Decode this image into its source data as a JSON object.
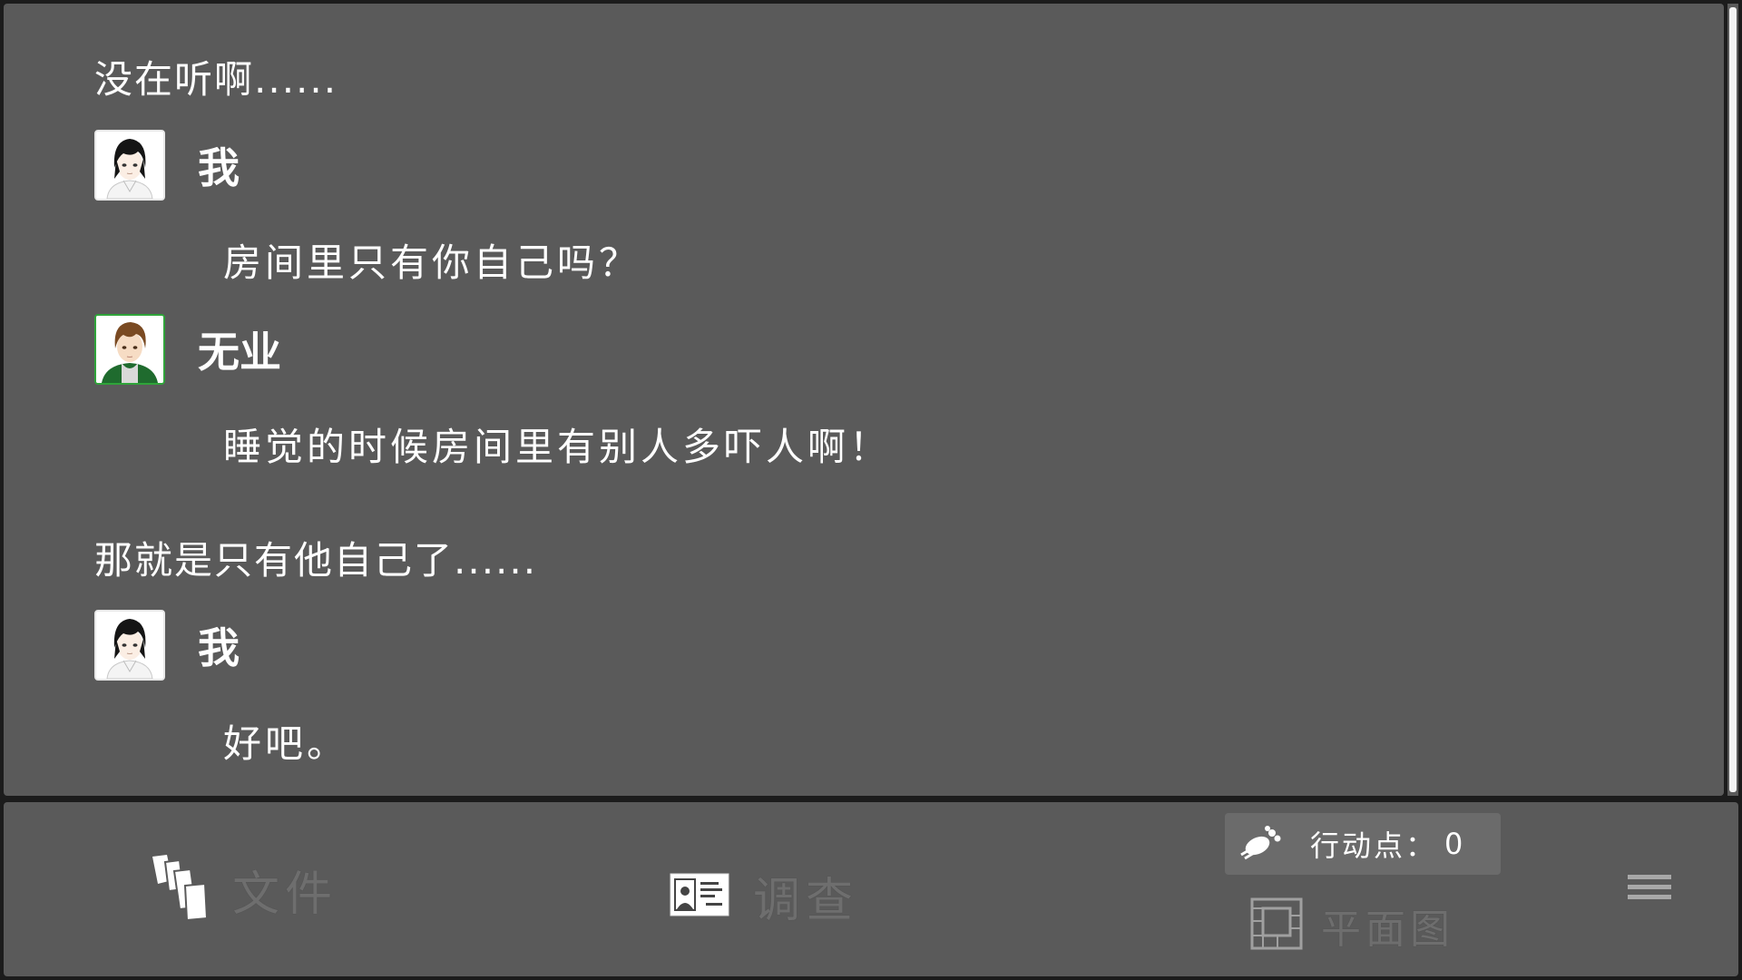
{
  "log": {
    "entries": [
      {
        "type": "narration",
        "text": "没在听啊......"
      },
      {
        "type": "speech",
        "speaker": "我",
        "avatar": "protagonist-portrait",
        "text": "房间里只有你自己吗？"
      },
      {
        "type": "speech",
        "speaker": "无业",
        "avatar": "unemployed-man-portrait",
        "text": "睡觉的时候房间里有别人多吓人啊！"
      },
      {
        "type": "narration",
        "text": "那就是只有他自己了......"
      },
      {
        "type": "speech",
        "speaker": "我",
        "avatar": "protagonist-portrait",
        "text": "好吧。"
      }
    ]
  },
  "toolbar": {
    "files_label": "文件",
    "files_icon": "documents-icon",
    "investigate_label": "调查",
    "investigate_icon": "id-card-icon",
    "action_points_label": "行动点：",
    "action_points_value": "0",
    "action_points_icon": "footprint-icon",
    "map_label": "平面图",
    "map_icon": "floor-plan-icon",
    "menu_icon": "hamburger-menu-icon"
  },
  "colors": {
    "panel_bg": "#5a5a5a",
    "text": "#ffffff",
    "disabled_text": "#6e6e6e",
    "avatar_highlight": "#2fa43a"
  }
}
